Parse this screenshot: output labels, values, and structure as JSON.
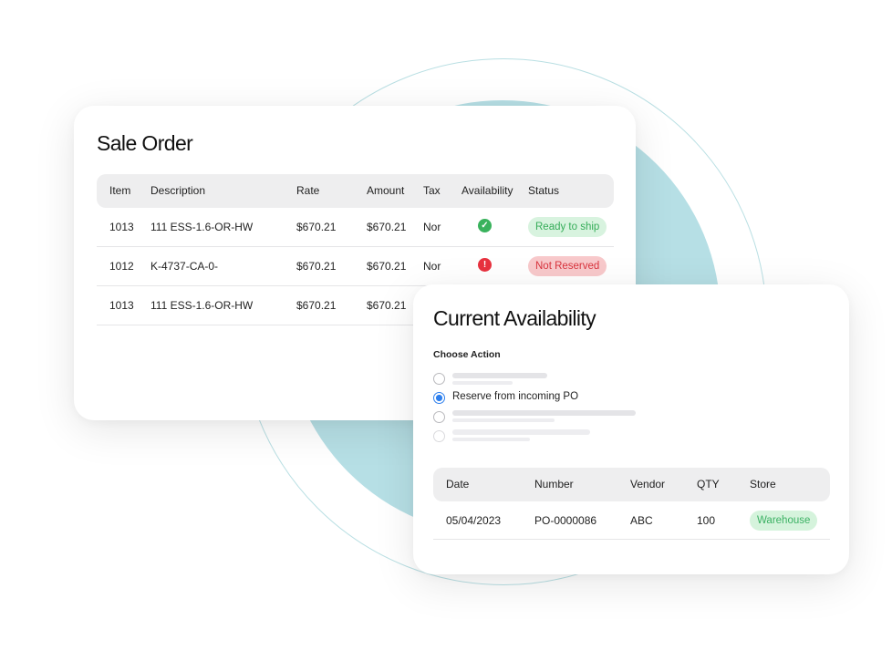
{
  "sale_order": {
    "title": "Sale Order",
    "columns": {
      "item": "Item",
      "description": "Description",
      "rate": "Rate",
      "amount": "Amount",
      "tax": "Tax",
      "availability": "Availability",
      "status": "Status"
    },
    "rows": [
      {
        "item": "1013",
        "description": "111 ESS-1.6-OR-HW",
        "rate": "$670.21",
        "amount": "$670.21",
        "tax": "Nor",
        "availability_icon": "check-icon",
        "status": "Ready to ship"
      },
      {
        "item": "1012",
        "description": "K-4737-CA-0-",
        "rate": "$670.21",
        "amount": "$670.21",
        "tax": "Nor",
        "availability_icon": "alert-icon",
        "status": "Not Reserved"
      },
      {
        "item": "1013",
        "description": "111 ESS-1.6-OR-HW",
        "rate": "$670.21",
        "amount": "$670.21"
      }
    ]
  },
  "current_availability": {
    "title": "Current Availability",
    "choose_action_label": "Choose Action",
    "options": [
      {
        "label": "",
        "selected": false
      },
      {
        "label": "Reserve from incoming PO",
        "selected": true
      },
      {
        "label": "",
        "selected": false
      },
      {
        "label": "",
        "selected": false
      }
    ],
    "columns": {
      "date": "Date",
      "number": "Number",
      "vendor": "Vendor",
      "qty": "QTY",
      "store": "Store"
    },
    "rows": [
      {
        "date": "05/04/2023",
        "number": "PO-0000086",
        "vendor": "ABC",
        "qty": "100",
        "store": "Warehouse"
      }
    ]
  },
  "colors": {
    "accent_teal": "#b6dfe5",
    "success_green": "#39b25c",
    "danger_red": "#e8323f",
    "radio_blue": "#2f80ed"
  }
}
